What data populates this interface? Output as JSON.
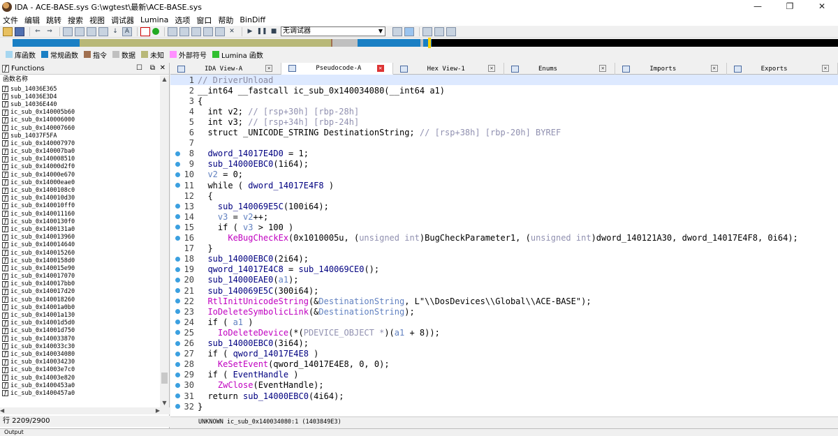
{
  "window": {
    "title": "IDA - ACE-BASE.sys G:\\wgtest\\最新\\ACE-BASE.sys",
    "minimize": "—",
    "maximize": "❐",
    "close": "✕"
  },
  "menu": [
    "文件",
    "编辑",
    "跳转",
    "搜索",
    "视图",
    "调试器",
    "Lumina",
    "选项",
    "窗口",
    "帮助",
    "BinDiff"
  ],
  "toolbar": {
    "debugger": "无调试器"
  },
  "legend": [
    {
      "label": "库函数",
      "color": "#a6d6f0"
    },
    {
      "label": "常规函数",
      "color": "#1a7fc4"
    },
    {
      "label": "指令",
      "color": "#a07050"
    },
    {
      "label": "数据",
      "color": "#c0c0c0"
    },
    {
      "label": "未知",
      "color": "#b8b878"
    },
    {
      "label": "外部符号",
      "color": "#ff90ff"
    },
    {
      "label": "Lumina 函数",
      "color": "#30c030"
    }
  ],
  "functions": {
    "title": "Functions",
    "column": "函数名称",
    "items": [
      "sub_14036E365",
      "sub_14036E3D4",
      "sub_14036E440",
      "ic_sub_0x140005b60",
      "ic_sub_0x140006000",
      "ic_sub_0x140007660",
      "sub_14037F5FA",
      "ic_sub_0x140007970",
      "ic_sub_0x140007ba0",
      "ic_sub_0x140008510",
      "ic_sub_0x14000d2f0",
      "ic_sub_0x14000e670",
      "ic_sub_0x14000eae0",
      "ic_sub_0x1400108c0",
      "ic_sub_0x140010d30",
      "ic_sub_0x140010ff0",
      "ic_sub_0x140011160",
      "ic_sub_0x1400130f0",
      "ic_sub_0x1400131a0",
      "ic_sub_0x140013960",
      "ic_sub_0x140014640",
      "ic_sub_0x140015260",
      "ic_sub_0x1400158d0",
      "ic_sub_0x140015e90",
      "ic_sub_0x140017070",
      "ic_sub_0x140017bb0",
      "ic_sub_0x140017d20",
      "ic_sub_0x140018260",
      "ic_sub_0x14001a0b0",
      "ic_sub_0x14001a130",
      "ic_sub_0x14001d5d0",
      "ic_sub_0x14001d750",
      "ic_sub_0x140033870",
      "ic_sub_0x140033c30",
      "ic_sub_0x140034080",
      "ic_sub_0x140034230",
      "ic_sub_0x14003e7c0",
      "ic_sub_0x14003e820",
      "ic_sub_0x1400453a0",
      "ic_sub_0x1400457a0"
    ],
    "status": "行 2209/2900"
  },
  "tabs": [
    {
      "label": "IDA View-A",
      "active": false
    },
    {
      "label": "Pseudocode-A",
      "active": true
    },
    {
      "label": "Hex View-1",
      "active": false
    },
    {
      "label": "Enums",
      "active": false
    },
    {
      "label": "Imports",
      "active": false
    },
    {
      "label": "Exports",
      "active": false
    }
  ],
  "code_status": "UNKNOWN ic_sub_0x140034080:1 (1403849E3)",
  "output_label": "Output",
  "code": [
    {
      "n": "1",
      "dot": false,
      "parts": [
        [
          "c-cmt",
          "// DriverUnload"
        ]
      ]
    },
    {
      "n": "2",
      "dot": false,
      "parts": [
        [
          "",
          "__int64 __fastcall ic_sub_0x140034080(__int64 a1)"
        ]
      ]
    },
    {
      "n": "3",
      "dot": false,
      "parts": [
        [
          "",
          "{"
        ]
      ]
    },
    {
      "n": "4",
      "dot": false,
      "parts": [
        [
          "",
          "  int v2; "
        ],
        [
          "c-gray",
          "// [rsp+30h] [rbp-28h]"
        ]
      ]
    },
    {
      "n": "5",
      "dot": false,
      "parts": [
        [
          "",
          "  int v3; "
        ],
        [
          "c-gray",
          "// [rsp+34h] [rbp-24h]"
        ]
      ]
    },
    {
      "n": "6",
      "dot": false,
      "parts": [
        [
          "",
          "  struct _UNICODE_STRING DestinationString; "
        ],
        [
          "c-gray",
          "// [rsp+38h] [rbp-20h] BYREF"
        ]
      ]
    },
    {
      "n": "7",
      "dot": false,
      "parts": [
        [
          "",
          ""
        ]
      ]
    },
    {
      "n": "8",
      "dot": true,
      "parts": [
        [
          "c-navy",
          "  dword_14017E4D0"
        ],
        [
          "",
          " = 1;"
        ]
      ]
    },
    {
      "n": "9",
      "dot": true,
      "parts": [
        [
          "c-navy",
          "  sub_14000EBC0"
        ],
        [
          "",
          "(1i64);"
        ]
      ]
    },
    {
      "n": "10",
      "dot": true,
      "parts": [
        [
          "c-var",
          "  v2"
        ],
        [
          "",
          " = 0;"
        ]
      ]
    },
    {
      "n": "11",
      "dot": true,
      "parts": [
        [
          "",
          "  while ( "
        ],
        [
          "c-navy",
          "dword_14017E4F8"
        ],
        [
          "",
          " )"
        ]
      ]
    },
    {
      "n": "12",
      "dot": false,
      "parts": [
        [
          "",
          "  {"
        ]
      ]
    },
    {
      "n": "13",
      "dot": true,
      "parts": [
        [
          "c-navy",
          "    sub_140069E5C"
        ],
        [
          "",
          "(100i64);"
        ]
      ]
    },
    {
      "n": "14",
      "dot": true,
      "parts": [
        [
          "c-var",
          "    v3"
        ],
        [
          "",
          " = "
        ],
        [
          "c-var",
          "v2"
        ],
        [
          "",
          "++;"
        ]
      ]
    },
    {
      "n": "15",
      "dot": true,
      "parts": [
        [
          "",
          "    if ( "
        ],
        [
          "c-var",
          "v3"
        ],
        [
          "",
          " > 100 )"
        ]
      ]
    },
    {
      "n": "16",
      "dot": true,
      "parts": [
        [
          "c-fn",
          "      KeBugCheckEx"
        ],
        [
          "",
          "(0x1010005u, ("
        ],
        [
          "c-gray",
          "unsigned int"
        ],
        [
          "",
          ")BugCheckParameter1, ("
        ],
        [
          "c-gray",
          "unsigned int"
        ],
        [
          "",
          ")dword_140121A30, dword_14017E4F8, 0i64);"
        ]
      ]
    },
    {
      "n": "17",
      "dot": false,
      "parts": [
        [
          "",
          "  }"
        ]
      ]
    },
    {
      "n": "18",
      "dot": true,
      "parts": [
        [
          "c-navy",
          "  sub_14000EBC0"
        ],
        [
          "",
          "(2i64);"
        ]
      ]
    },
    {
      "n": "19",
      "dot": true,
      "parts": [
        [
          "c-navy",
          "  qword_14017E4C8"
        ],
        [
          "",
          " = "
        ],
        [
          "c-navy",
          "sub_140069CE0"
        ],
        [
          "",
          "();"
        ]
      ]
    },
    {
      "n": "20",
      "dot": true,
      "parts": [
        [
          "c-navy",
          "  sub_14000EAE0"
        ],
        [
          "",
          "("
        ],
        [
          "c-var",
          "a1"
        ],
        [
          "",
          ");"
        ]
      ]
    },
    {
      "n": "21",
      "dot": true,
      "parts": [
        [
          "c-navy",
          "  sub_140069E5C"
        ],
        [
          "",
          "(300i64);"
        ]
      ]
    },
    {
      "n": "22",
      "dot": true,
      "parts": [
        [
          "c-fn",
          "  RtlInitUnicodeString"
        ],
        [
          "",
          "(&"
        ],
        [
          "c-var",
          "DestinationString"
        ],
        [
          "",
          ", L\"\\\\DosDevices\\\\Global\\\\ACE-BASE\");"
        ]
      ]
    },
    {
      "n": "23",
      "dot": true,
      "parts": [
        [
          "c-fn",
          "  IoDeleteSymbolicLink"
        ],
        [
          "",
          "(&"
        ],
        [
          "c-var",
          "DestinationString"
        ],
        [
          "",
          ");"
        ]
      ]
    },
    {
      "n": "24",
      "dot": true,
      "parts": [
        [
          "",
          "  if ( "
        ],
        [
          "c-var",
          "a1"
        ],
        [
          "",
          " )"
        ]
      ]
    },
    {
      "n": "25",
      "dot": true,
      "parts": [
        [
          "c-fn",
          "    IoDeleteDevice"
        ],
        [
          "",
          "(*("
        ],
        [
          "c-gray",
          "PDEVICE_OBJECT *"
        ],
        [
          "",
          ")("
        ],
        [
          "c-var",
          "a1"
        ],
        [
          "",
          " + 8));"
        ]
      ]
    },
    {
      "n": "26",
      "dot": true,
      "parts": [
        [
          "c-navy",
          "  sub_14000EBC0"
        ],
        [
          "",
          "(3i64);"
        ]
      ]
    },
    {
      "n": "27",
      "dot": true,
      "parts": [
        [
          "",
          "  if ( "
        ],
        [
          "c-navy",
          "qword_14017E4E8"
        ],
        [
          "",
          " )"
        ]
      ]
    },
    {
      "n": "28",
      "dot": true,
      "parts": [
        [
          "c-fn",
          "    KeSetEvent"
        ],
        [
          "",
          "(qword_14017E4E8, 0, 0);"
        ]
      ]
    },
    {
      "n": "29",
      "dot": true,
      "parts": [
        [
          "",
          "  if ( "
        ],
        [
          "c-navy",
          "EventHandle"
        ],
        [
          "",
          " )"
        ]
      ]
    },
    {
      "n": "30",
      "dot": true,
      "parts": [
        [
          "c-fn",
          "    ZwClose"
        ],
        [
          "",
          "(EventHandle);"
        ]
      ]
    },
    {
      "n": "31",
      "dot": true,
      "parts": [
        [
          "",
          "  return "
        ],
        [
          "c-navy",
          "sub_14000EBC0"
        ],
        [
          "",
          "(4i64);"
        ]
      ]
    },
    {
      "n": "32",
      "dot": true,
      "parts": [
        [
          "",
          "}"
        ]
      ]
    }
  ]
}
